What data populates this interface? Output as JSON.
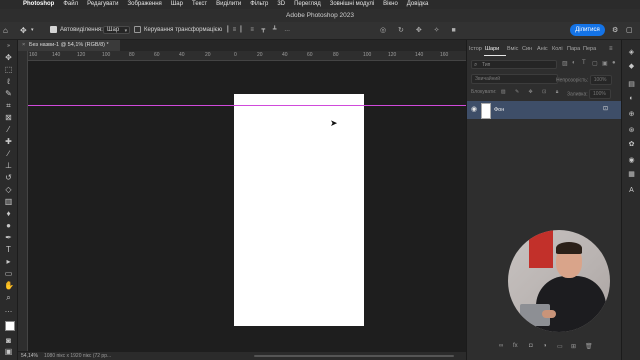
{
  "menubar": {
    "app_name": "Photoshop",
    "items": [
      "Файл",
      "Редагувати",
      "Зображення",
      "Шар",
      "Текст",
      "Виділити",
      "Фільтр",
      "3D",
      "Перегляд",
      "Зовнішні модулі",
      "Вікно",
      "Довідка"
    ]
  },
  "window": {
    "title": "Adobe Photoshop 2023"
  },
  "options_bar": {
    "auto_select_label": "Автовиділення:",
    "auto_select_checked": true,
    "auto_select_value": "Шар",
    "transform_controls_label": "Керування трансформацією",
    "transform_controls_checked": false,
    "share_label": "Ділитися"
  },
  "document": {
    "tab_title": "Без назви-1 @ 54,1% (RGB/8) *",
    "background_color": "#ffffff",
    "guide_color": "#d04adb"
  },
  "ruler": {
    "ticks": [
      "160",
      "140",
      "120",
      "100",
      "80",
      "60",
      "40",
      "20",
      "0",
      "20",
      "40",
      "60",
      "80",
      "100",
      "120",
      "140",
      "160",
      "180"
    ]
  },
  "status_bar": {
    "zoom": "54,14%",
    "info": "1080 пікс x 1920 пікс (72 pp..."
  },
  "panels": {
    "tabs": [
      "Істор",
      "Шари",
      "Вміс",
      "Син",
      "Аніс",
      "Колі",
      "Пара",
      "Пера"
    ],
    "active_tab": "Шари",
    "search_placeholder": "Тип",
    "blend_mode": "Звичайний",
    "opacity_label": "Непрозорість:",
    "opacity_value": "100%",
    "lock_label": "Блокувати:",
    "fill_label": "Заливка:",
    "fill_value": "100%",
    "layers": [
      {
        "name": "Фон",
        "visible": true,
        "locked": true,
        "selected": true
      }
    ]
  },
  "colors": {
    "accent": "#1473e6",
    "selected_layer": "#3e4e68",
    "canvas_bg": "#1e1e1e"
  }
}
